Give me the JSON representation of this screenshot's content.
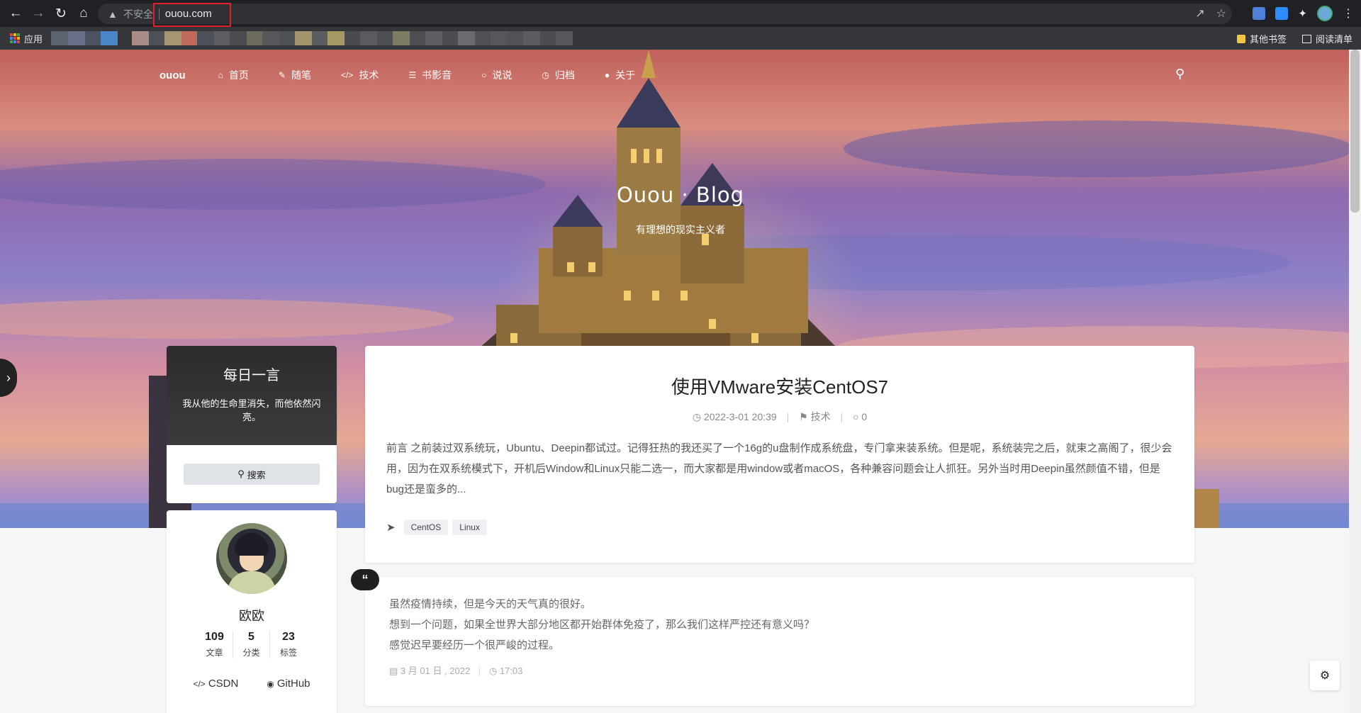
{
  "browser": {
    "security_label": "不安全",
    "url": "ouou.com",
    "bookmarks_apps_label": "应用",
    "other_bookmarks_label": "其他书签",
    "reading_list_label": "阅读清单"
  },
  "navbar": {
    "brand": "ouou",
    "items": [
      {
        "label": "首页",
        "icon": "home-icon"
      },
      {
        "label": "随笔",
        "icon": "pencil-icon"
      },
      {
        "label": "技术",
        "icon": "code-icon"
      },
      {
        "label": "书影音",
        "icon": "book-icon"
      },
      {
        "label": "说说",
        "icon": "chat-icon"
      },
      {
        "label": "归档",
        "icon": "clock-icon"
      },
      {
        "label": "关于",
        "icon": "user-icon"
      }
    ]
  },
  "hero": {
    "title": "Ouou · Blog",
    "subtitle": "有理想的现实主义者"
  },
  "daily_quote": {
    "heading": "每日一言",
    "text": "我从他的生命里消失，而他依然闪亮。",
    "search_label": "搜索"
  },
  "profile": {
    "name": "欧欧",
    "stats": [
      {
        "num": "109",
        "label": "文章"
      },
      {
        "num": "5",
        "label": "分类"
      },
      {
        "num": "23",
        "label": "标签"
      }
    ],
    "links": [
      {
        "label": "CSDN",
        "icon": "code-icon"
      },
      {
        "label": "GitHub",
        "icon": "github-icon"
      }
    ]
  },
  "post": {
    "title": "使用VMware安装CentOS7",
    "date": "2022-3-01 20:39",
    "category": "技术",
    "comments": "0",
    "excerpt": "前言 之前装过双系统玩，Ubuntu、Deepin都试过。记得狂热的我还买了一个16g的u盘制作成系统盘，专门拿来装系统。但是呢，系统装完之后，就束之高阁了，很少会用，因为在双系统模式下，开机后Window和Linux只能二选一，而大家都是用window或者macOS，各种兼容问题会让人抓狂。另外当时用Deepin虽然颜值不错，但是bug还是蛮多的...",
    "tags": [
      "CentOS",
      "Linux"
    ]
  },
  "talk": {
    "lines": [
      "虽然疫情持续，但是今天的天气真的很好。",
      "想到一个问题，如果全世界大部分地区都开始群体免疫了，那么我们这样严控还有意义吗？",
      "感觉迟早要经历一个很严峻的过程。"
    ],
    "date": "3 月 01 日 , 2022",
    "time": "17:03"
  }
}
